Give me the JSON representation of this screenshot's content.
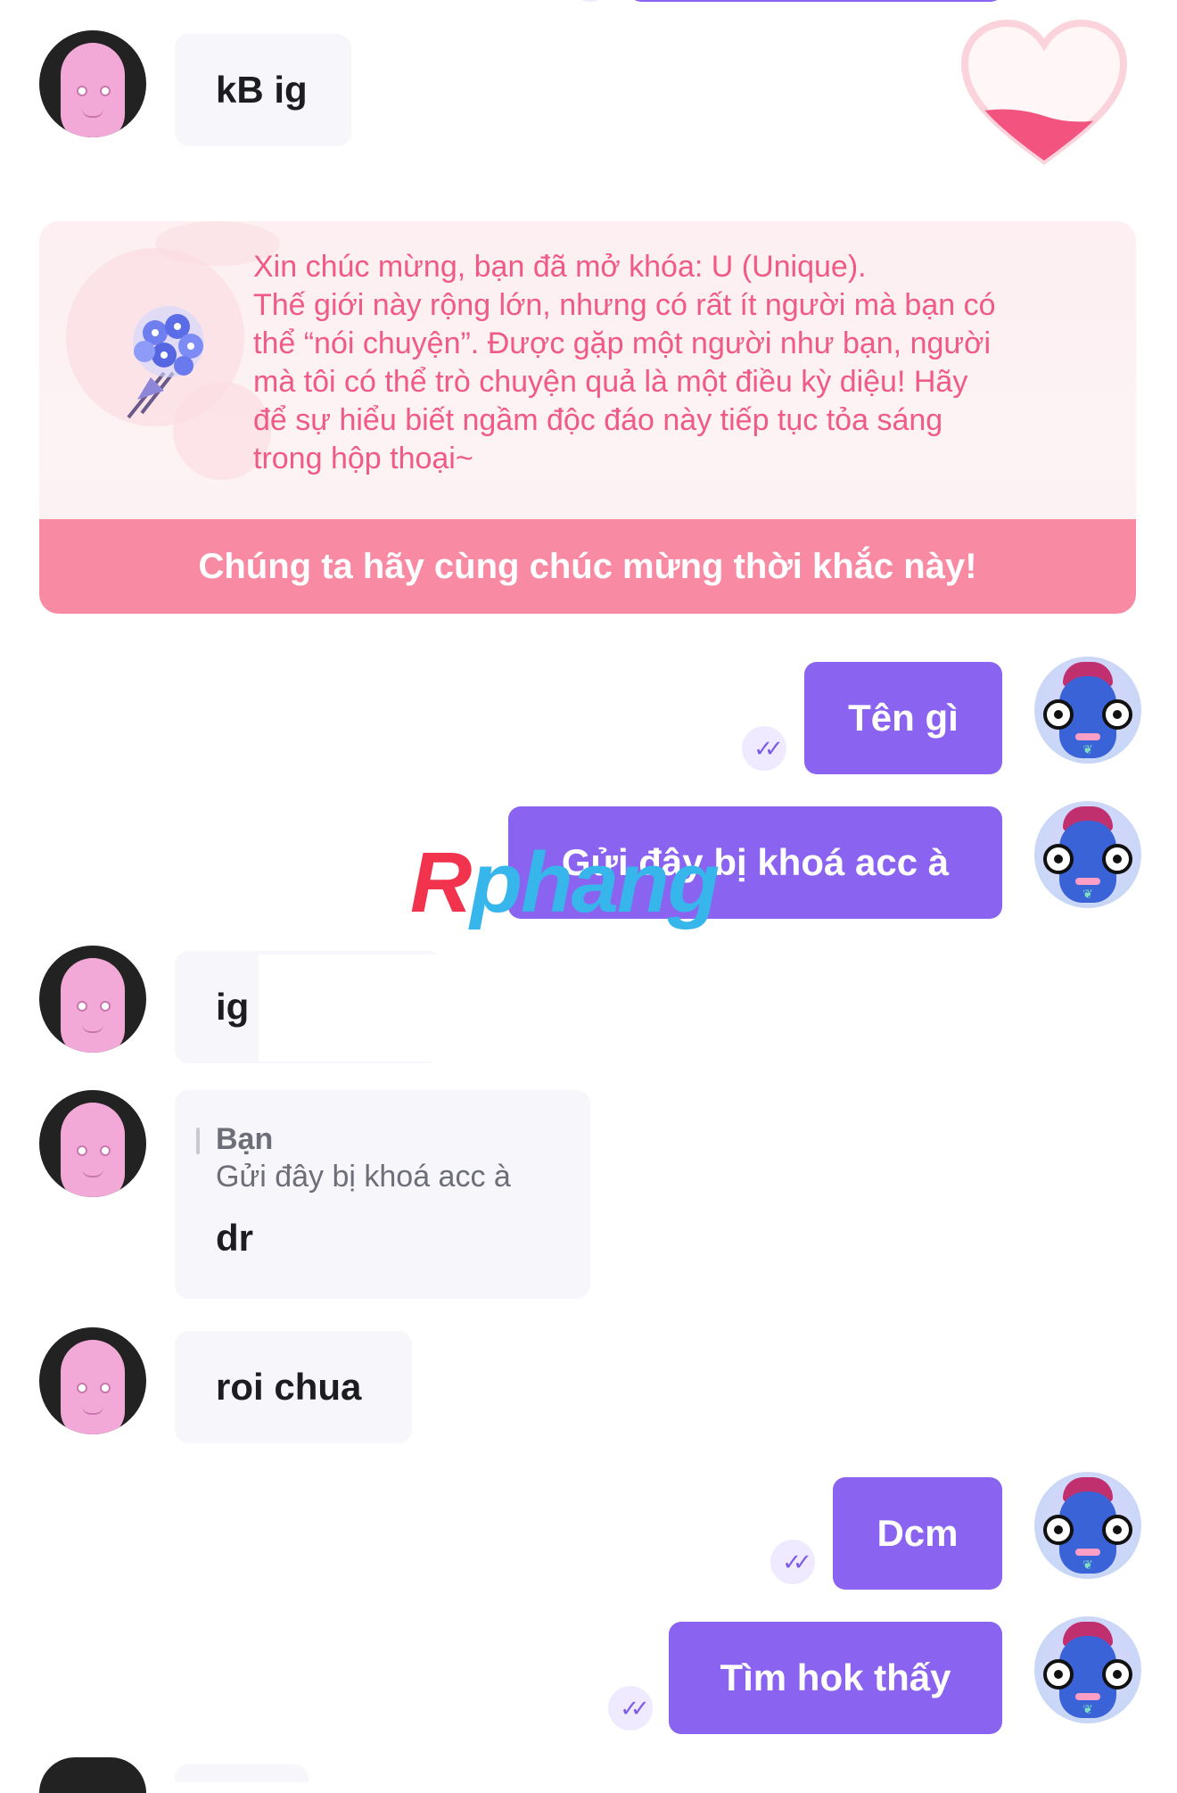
{
  "chat": {
    "card": {
      "lines": [
        "Xin chúc mừng, bạn đã mở khóa: U (Unique).",
        "Thế giới này rộng lớn, nhưng có rất ít người mà bạn có",
        "thể “nói chuyện”. Được gặp một người như bạn, người",
        "mà tôi có thể trò chuyện quả là một điều kỳ diệu! Hãy",
        "để sự hiểu biết ngầm độc đáo này tiếp tục tỏa sáng",
        "trong hộp thoại~"
      ],
      "banner": "Chúng ta hãy cùng chúc mừng thời khắc này!"
    },
    "messages": [
      {
        "side": "in",
        "text": "kB ig"
      },
      {
        "side": "out",
        "text": "Tên gì"
      },
      {
        "side": "out",
        "text": "Gửi đây bị khoá acc à"
      },
      {
        "side": "in",
        "text": "ig"
      },
      {
        "side": "in",
        "reply_author": "Bạn",
        "reply_quote": "Gửi đây bị khoá acc à",
        "text": "dr"
      },
      {
        "side": "in",
        "text": "roi chua"
      },
      {
        "side": "out",
        "text": "Dcm"
      },
      {
        "side": "out",
        "text": "Tìm hok thấy"
      }
    ],
    "read_receipt_icon": "double-check-icon"
  },
  "watermark": {
    "part1": "R",
    "part2": "phang"
  },
  "colors": {
    "outgoing_bubble": "#8a63f0",
    "incoming_bubble": "#f6f6fb",
    "card_text": "#ef5b86",
    "card_banner": "#f98aa4"
  }
}
